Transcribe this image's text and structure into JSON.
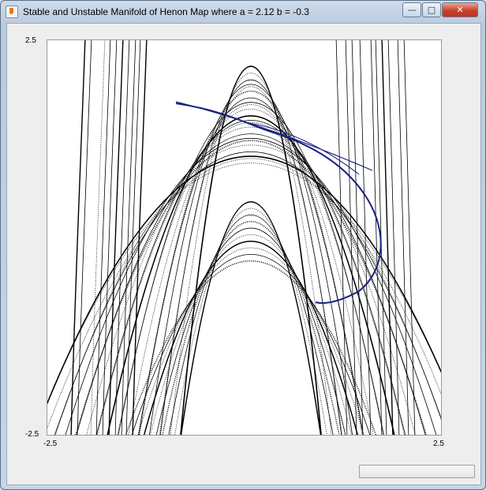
{
  "window": {
    "title": "Stable and Unstable Manifold of Henon Map where a = 2.12 b = -0.3",
    "minimize_glyph": "—",
    "maximize_glyph": "□",
    "close_glyph": "✕"
  },
  "chart_data": {
    "type": "scatter",
    "title": "",
    "xlabel": "",
    "ylabel": "",
    "xlim": [
      -2.5,
      2.5
    ],
    "ylim": [
      -2.5,
      2.5
    ],
    "x_tick_labels": [
      "-2.5",
      "2.5"
    ],
    "y_tick_labels": [
      "2.5",
      "-2.5"
    ],
    "grid": false,
    "series": [
      {
        "color": "#000000",
        "curves": "stable-manifold"
      },
      {
        "color": "#1a237e",
        "curves": "unstable-manifold"
      }
    ]
  },
  "progress": {
    "value": 0
  }
}
